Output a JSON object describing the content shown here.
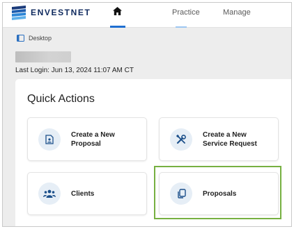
{
  "brand": {
    "name": "ENVESTNET"
  },
  "nav": {
    "home_icon": "home-icon",
    "items": [
      {
        "label": "Practice"
      },
      {
        "label": "Manage"
      }
    ]
  },
  "breadcrumb": {
    "icon": "desktop-icon",
    "label": "Desktop"
  },
  "user": {
    "last_login": "Last Login: Jun 13, 2024 11:07 AM CT"
  },
  "quick_actions": {
    "title": "Quick Actions",
    "tiles": [
      {
        "label_line1": "Create a New",
        "label_line2": "Proposal",
        "icon": "proposal-document-icon"
      },
      {
        "label_line1": "Create a New",
        "label_line2": "Service Request",
        "icon": "tools-icon"
      },
      {
        "label_line1": "Clients",
        "label_line2": "",
        "icon": "clients-group-icon"
      },
      {
        "label_line1": "Proposals",
        "label_line2": "",
        "icon": "proposals-copy-icon"
      }
    ]
  },
  "colors": {
    "brand_navy": "#0f2a5e",
    "nav_active": "#1f6fd1",
    "icon_bg": "#e6eef6",
    "icon_fg": "#1b4f8a",
    "highlight": "#76b041",
    "page_bg": "#ededed"
  }
}
